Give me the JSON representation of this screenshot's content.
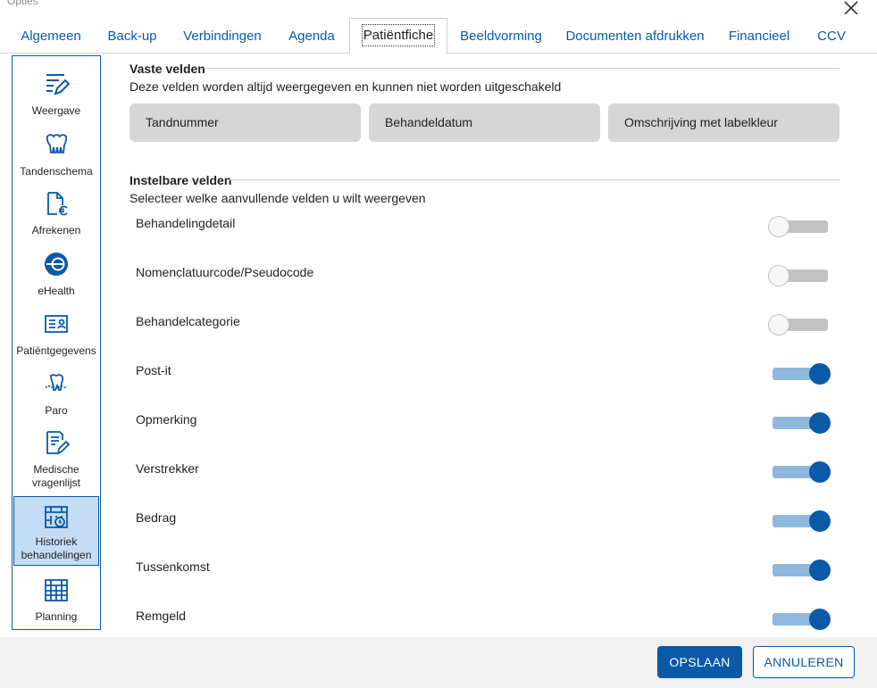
{
  "window": {
    "title": "Opties"
  },
  "tabs": [
    {
      "label": "Algemeen"
    },
    {
      "label": "Back-up"
    },
    {
      "label": "Verbindingen"
    },
    {
      "label": "Agenda"
    },
    {
      "label": "Patiëntfiche",
      "active": true
    },
    {
      "label": "Beeldvorming"
    },
    {
      "label": "Documenten afdrukken"
    },
    {
      "label": "Financieel"
    },
    {
      "label": "CCV"
    }
  ],
  "sidebar": {
    "items": [
      {
        "label": "Weergave",
        "icon": "display-settings-icon"
      },
      {
        "label": "Tandenschema",
        "icon": "teeth-icon"
      },
      {
        "label": "Afrekenen",
        "icon": "invoice-euro-icon"
      },
      {
        "label": "eHealth",
        "icon": "ehealth-icon"
      },
      {
        "label": "Patiëntgegevens",
        "icon": "id-card-icon"
      },
      {
        "label": "Paro",
        "icon": "gum-tooth-icon"
      },
      {
        "label": "Medische",
        "label2": "vragenlijst",
        "icon": "questionnaire-icon"
      },
      {
        "label": "Historiek",
        "label2": "behandelingen",
        "icon": "calendar-history-icon",
        "active": true
      },
      {
        "label": "Planning",
        "icon": "calendar-icon"
      }
    ]
  },
  "fixed_section": {
    "title": "Vaste velden",
    "description": "Deze velden worden altijd weergegeven en kunnen niet worden uitgeschakeld",
    "fields": [
      "Tandnummer",
      "Behandeldatum",
      "Omschrijving met labelkleur"
    ]
  },
  "configurable_section": {
    "title": "Instelbare velden",
    "description": "Selecteer welke aanvullende velden u wilt weergeven",
    "fields": [
      {
        "label": "Behandelingdetail",
        "enabled": false
      },
      {
        "label": "Nomenclatuurcode/Pseudocode",
        "enabled": false
      },
      {
        "label": "Behandelcategorie",
        "enabled": false
      },
      {
        "label": "Post-it",
        "enabled": true
      },
      {
        "label": "Opmerking",
        "enabled": true
      },
      {
        "label": "Verstrekker",
        "enabled": true
      },
      {
        "label": "Bedrag",
        "enabled": true
      },
      {
        "label": "Tussenkomst",
        "enabled": true
      },
      {
        "label": "Remgeld",
        "enabled": true
      }
    ]
  },
  "footer": {
    "save_label": "OPSLAAN",
    "cancel_label": "ANNULEREN"
  },
  "colors": {
    "accent": "#0a5aa8",
    "toggle_on_track": "#8fb8dd",
    "toggle_off_track": "#c2c2c2",
    "fixed_field_bg": "#d6d6d6",
    "active_side_bg": "#c5dcf5"
  }
}
